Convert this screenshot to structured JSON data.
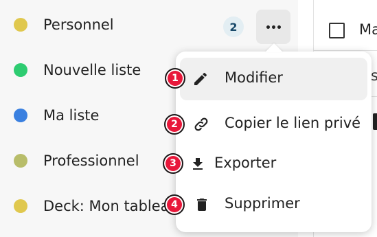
{
  "sidebar": {
    "items": [
      {
        "label": "Personnel",
        "color": "#e0c84e",
        "count": "2"
      },
      {
        "label": "Nouvelle liste",
        "color": "#2ecc71"
      },
      {
        "label": "Ma liste",
        "color": "#3a80e0"
      },
      {
        "label": "Professionnel",
        "color": "#b8bd6a"
      },
      {
        "label": "Deck: Mon tableau",
        "color": "#e0c84e"
      }
    ],
    "more_button_icon": "more-horizontal-icon"
  },
  "task_panel": {
    "title": "Ma",
    "partial_text": "s"
  },
  "menu": {
    "items": [
      {
        "label": "Modifier",
        "icon": "pencil-icon",
        "step": "1"
      },
      {
        "label": "Copier le lien privé",
        "icon": "link-icon",
        "step": "2"
      },
      {
        "label": "Exporter",
        "icon": "download-icon",
        "step": "3"
      },
      {
        "label": "Supprimer",
        "icon": "trash-icon",
        "step": "4"
      }
    ]
  },
  "colors": {
    "step_badge": "#e8173a",
    "active_item_bg": "#f0f0f0"
  }
}
